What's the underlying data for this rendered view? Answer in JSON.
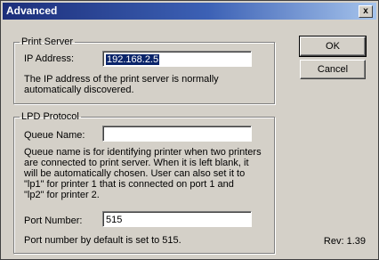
{
  "window": {
    "title": "Advanced",
    "close_glyph": "x"
  },
  "print_server": {
    "legend": "Print Server",
    "ip_label": "IP Address:",
    "ip_value": "192.168.2.5",
    "description": "The IP address of the print server is normally\nautomatically discovered."
  },
  "lpd": {
    "legend": "LPD Protocol",
    "queue_label": "Queue Name:",
    "queue_value": "",
    "queue_description": "Queue name is for identifying printer when two printers\nare connected to print server. When it is left blank, it\nwill be automatically chosen. User can also set it to\n\"lp1\" for printer 1 that is connected on port 1 and\n\"lp2\" for printer 2.",
    "port_label": "Port Number:",
    "port_value": "515",
    "port_description": "Port number by default is set to 515."
  },
  "buttons": {
    "ok": "OK",
    "cancel": "Cancel"
  },
  "revision": "Rev: 1.39"
}
